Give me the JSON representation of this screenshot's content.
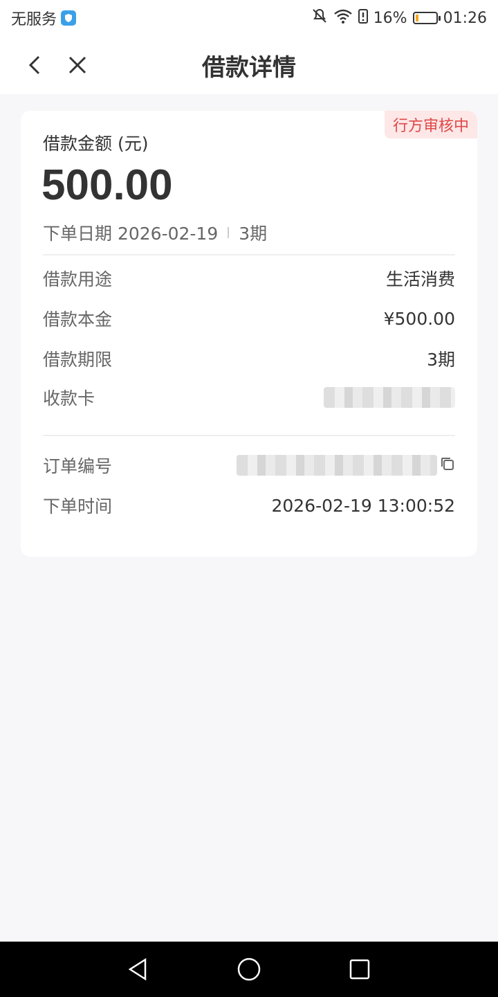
{
  "status_bar": {
    "carrier": "无服务",
    "battery_percent": "16%",
    "battery_level": 0.16,
    "time": "01:26"
  },
  "nav": {
    "title": "借款详情"
  },
  "card": {
    "status_badge": "行方审核中",
    "amount_label": "借款金额 (元)",
    "amount_value": "500.00",
    "order_date": "下单日期 2026-02-19",
    "periods": "3期",
    "rows": [
      {
        "label": "借款用途",
        "value": "生活消费"
      },
      {
        "label": "借款本金",
        "value": "¥500.00"
      },
      {
        "label": "借款期限",
        "value": "3期"
      },
      {
        "label": "收款卡",
        "value": ""
      }
    ],
    "order_rows": [
      {
        "label": "订单编号",
        "value": ""
      },
      {
        "label": "下单时间",
        "value": "2026-02-19 13:00:52"
      }
    ]
  },
  "colors": {
    "badge_bg": "#fde7e7",
    "badge_text": "#e04848",
    "page_bg": "#f7f7f9"
  }
}
